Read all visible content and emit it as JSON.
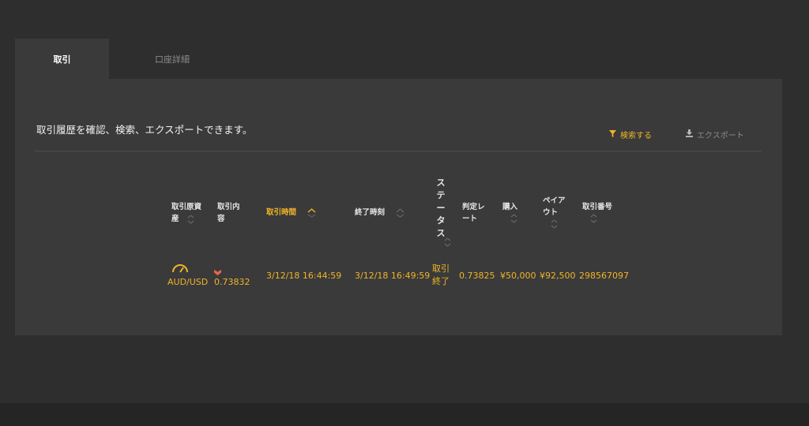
{
  "tabs": [
    {
      "label": "取引",
      "active": true
    },
    {
      "label": "口座詳細",
      "active": false
    }
  ],
  "description": "取引履歴を確認、検索、エクスポートできます。",
  "actions": {
    "search_label": "検索する",
    "export_label": "エクスポート"
  },
  "table": {
    "headers": {
      "asset_line1": "取引原資",
      "asset_line2": "産",
      "content_line1": "取引内",
      "content_line2": "容",
      "trade_time": "取引時間",
      "end_time": "終了時刻",
      "status_1": "ス",
      "status_2": "テ",
      "status_3": "ー",
      "status_4": "タ",
      "status_5": "ス",
      "rate_line1": "判定レ",
      "rate_line2": "ート",
      "purchase": "購入",
      "payout_line1": "ペイア",
      "payout_line2": "ウト",
      "trade_no": "取引番号"
    },
    "row": {
      "asset": "AUD/USD",
      "content_rate": "0.73832",
      "trade_time": "3/12/18 16:44:59",
      "end_time": "3/12/18 16:49:59",
      "status_line1": "取引",
      "status_line2": "終了",
      "judge_rate": "0.73825",
      "purchase": "¥50,000",
      "payout": "¥92,500",
      "trade_no": "298567097"
    }
  },
  "colors": {
    "accent": "#f0b429",
    "down": "#e8654a",
    "background": "#2e2e2e",
    "panel": "#3a3a3a"
  },
  "icons": {
    "search": "filter-icon",
    "export": "download-icon",
    "asset": "gauge-icon",
    "content": "down-arrow-icon"
  }
}
